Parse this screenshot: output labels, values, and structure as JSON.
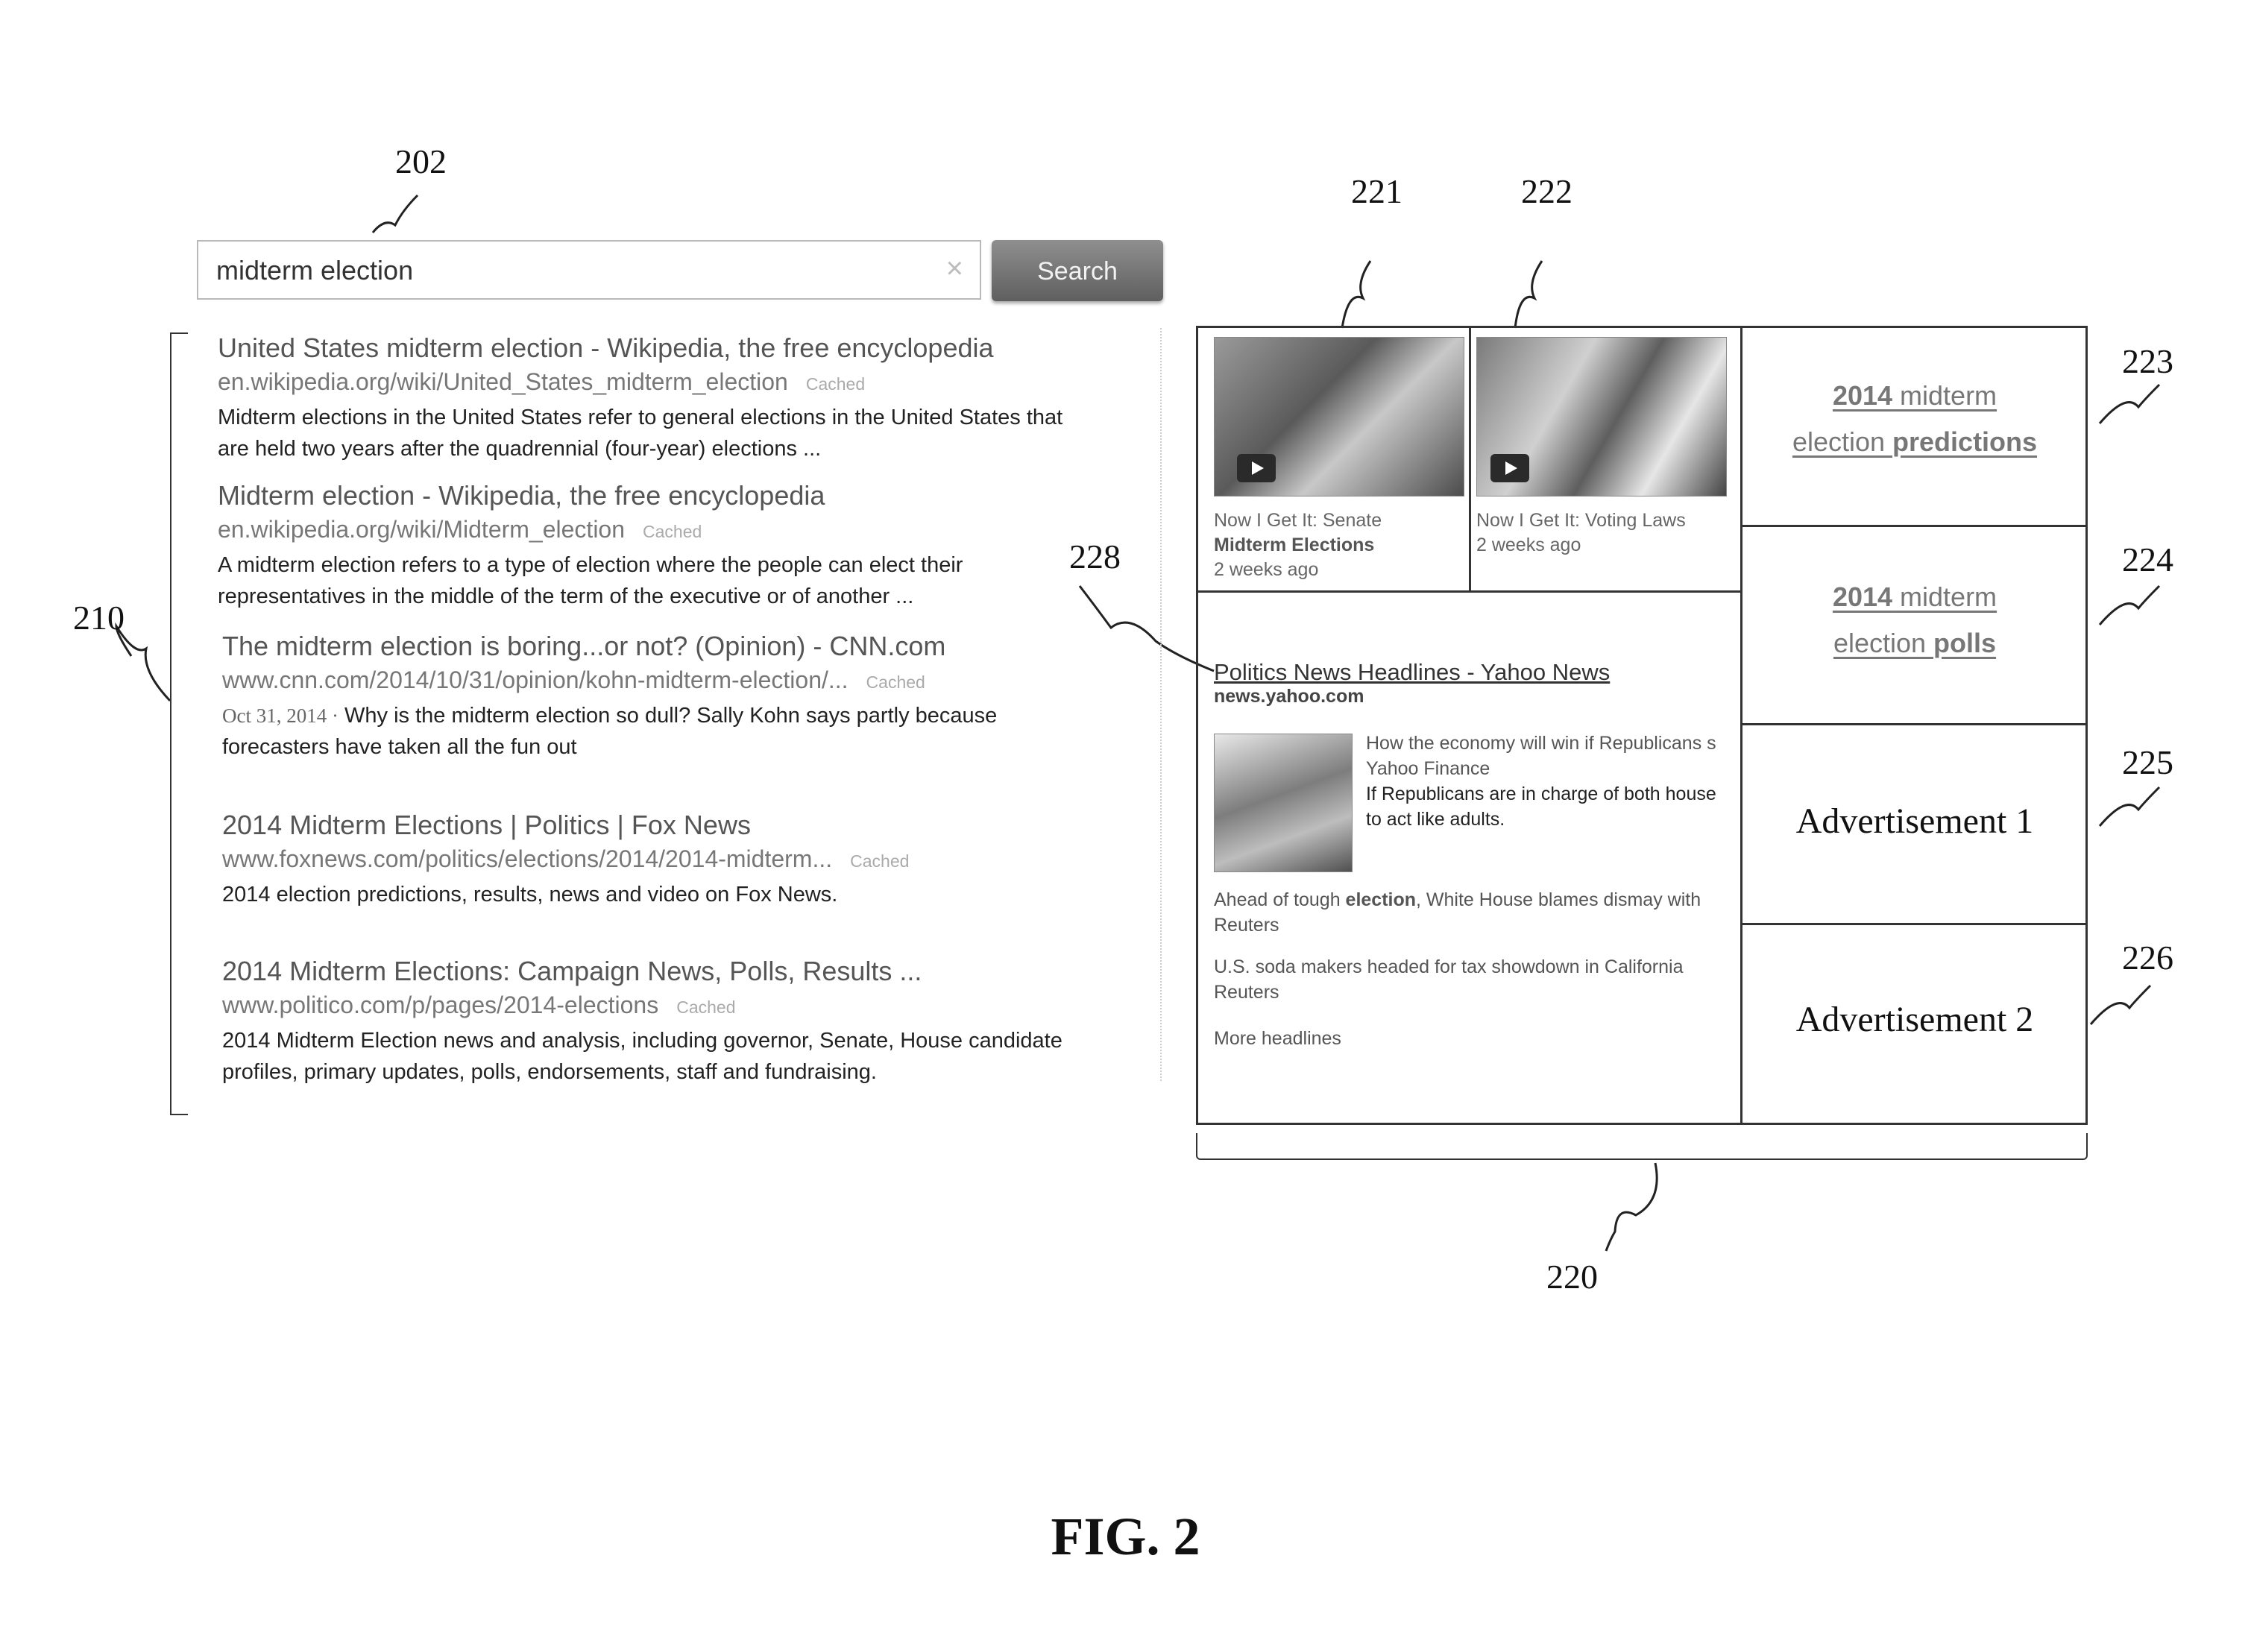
{
  "refs": {
    "r202": "202",
    "r210": "210",
    "r220": "220",
    "r221": "221",
    "r222": "222",
    "r223": "223",
    "r224": "224",
    "r225": "225",
    "r226": "226",
    "r228": "228"
  },
  "search": {
    "query": "midterm election",
    "clear_icon": "×",
    "button_label": "Search"
  },
  "results": [
    {
      "title": "United States midterm election - Wikipedia, the free encyclopedia",
      "url": "en.wikipedia.org/wiki/United_States_midterm_election",
      "cached": "Cached",
      "desc1": "Midterm elections in the United States refer to general elections in the United States that",
      "desc2": "are held two years after the quadrennial (four-year) elections ..."
    },
    {
      "title": "Midterm election - Wikipedia, the free encyclopedia",
      "url": "en.wikipedia.org/wiki/Midterm_election",
      "cached": "Cached",
      "desc1": "A midterm election refers to a type of election where the people can elect their",
      "desc2": "representatives in the middle of the term of the executive or of another ..."
    },
    {
      "title": "The midterm election is boring...or not? (Opinion) - CNN.com",
      "url": "www.cnn.com/2014/10/31/opinion/kohn-midterm-election/...",
      "cached": "Cached",
      "date": "Oct 31, 2014 ·",
      "desc1": "Why is the midterm election so dull? Sally Kohn says partly because",
      "desc2": "forecasters have taken all the fun out"
    },
    {
      "title": "2014 Midterm Elections | Politics | Fox News",
      "url": "www.foxnews.com/politics/elections/2014/2014-midterm...",
      "cached": "Cached",
      "desc1": "2014 election predictions, results, news and video on Fox News."
    },
    {
      "title": "2014 Midterm Elections: Campaign News, Polls, Results ...",
      "url": "www.politico.com/p/pages/2014-elections",
      "cached": "Cached",
      "desc1": "2014 Midterm Election news and analysis, including governor, Senate, House candidate",
      "desc2": "profiles, primary updates, polls, endorsements, staff and fundraising."
    }
  ],
  "videos": [
    {
      "line1": "Now I Get It: Senate",
      "line2": "Midterm Elections",
      "age": "2 weeks ago"
    },
    {
      "line1": "Now I Get It: Voting Laws",
      "age": "2 weeks ago"
    }
  ],
  "predictions": {
    "a_bold": "2014",
    "a_rest": " midterm",
    "a_line2": "election ",
    "a_bold2": "predictions",
    "b_bold": "2014",
    "b_rest": " midterm",
    "b_line2": "election ",
    "b_bold2": "polls"
  },
  "ads": {
    "ad1": "Advertisement 1",
    "ad2": "Advertisement 2"
  },
  "news": {
    "link": "Politics News Headlines - Yahoo News",
    "domain": "news.yahoo.com",
    "story_title": "How the economy will win if Republicans s",
    "story_source": "Yahoo Finance",
    "story_desc1": "If Republicans are in charge of both house",
    "story_desc2": "to act like adults.",
    "h1_pre": "Ahead of tough ",
    "h1_bold": "election",
    "h1_post": ", White House blames dismay with",
    "h1_src": "Reuters",
    "h2": "U.S. soda makers headed for tax showdown in California",
    "h2_src": "Reuters",
    "more": "More headlines"
  },
  "figure_caption": "FIG. 2"
}
